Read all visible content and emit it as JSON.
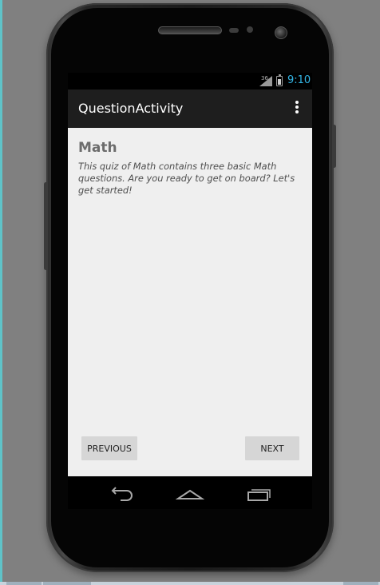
{
  "status_bar": {
    "signal_label": "36",
    "time": "9:10"
  },
  "action_bar": {
    "title": "QuestionActivity"
  },
  "content": {
    "topic_title": "Math",
    "topic_description": "This quiz of Math contains three basic Math questions. Are you ready to get on board? Let's get started!"
  },
  "buttons": {
    "previous": "PREVIOUS",
    "next": "NEXT"
  },
  "nav_bar": {
    "icons": [
      "back-icon",
      "home-icon",
      "recent-apps-icon"
    ]
  },
  "colors": {
    "action_bar": "#1e1e1e",
    "clock": "#33b5e5",
    "content_bg": "#efefef",
    "button_bg": "#d6d6d6"
  }
}
